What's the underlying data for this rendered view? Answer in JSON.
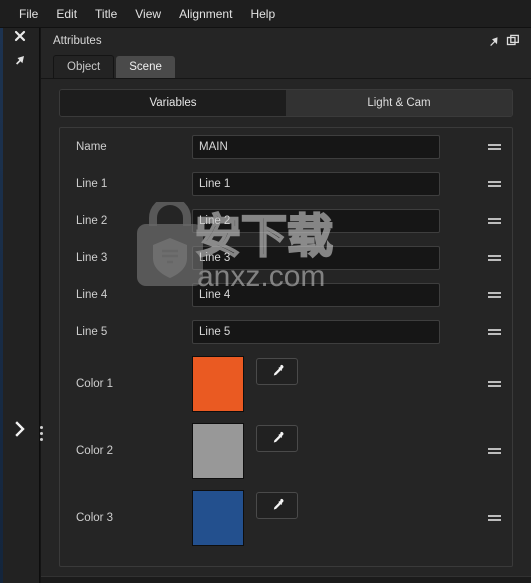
{
  "menubar": {
    "items": [
      {
        "label": "File"
      },
      {
        "label": "Edit"
      },
      {
        "label": "Title"
      },
      {
        "label": "View"
      },
      {
        "label": "Alignment"
      },
      {
        "label": "Help"
      }
    ]
  },
  "rail": {
    "close_icon": "close-icon",
    "arrow_icon": "cursor-arrow-icon",
    "expand_icon": "chevron-right-icon",
    "expand_glyph": "❯",
    "close_glyph": "✖",
    "arrow_glyph": "➤"
  },
  "panel": {
    "title": "Attributes",
    "pin_icon": "pin-icon",
    "float_icon": "float-window-icon",
    "tabs": [
      {
        "label": "Object",
        "active": false
      },
      {
        "label": "Scene",
        "active": true
      }
    ]
  },
  "segmented": {
    "options": [
      {
        "label": "Variables",
        "selected": true
      },
      {
        "label": "Light & Cam",
        "selected": false
      }
    ]
  },
  "variables": {
    "text_rows": [
      {
        "label": "Name",
        "value": "MAIN"
      },
      {
        "label": "Line 1",
        "value": "Line 1"
      },
      {
        "label": "Line 2",
        "value": "Line 2"
      },
      {
        "label": "Line 3",
        "value": "Line 3"
      },
      {
        "label": "Line 4",
        "value": "Line 4"
      },
      {
        "label": "Line 5",
        "value": "Line 5"
      }
    ],
    "color_rows": [
      {
        "label": "Color 1",
        "color": "#EA5A22",
        "picker_icon": "eyedropper-icon"
      },
      {
        "label": "Color 2",
        "color": "#989898",
        "picker_icon": "eyedropper-icon"
      },
      {
        "label": "Color 3",
        "color": "#23508E",
        "picker_icon": "eyedropper-icon"
      }
    ],
    "drag_handle_icon": "drag-handle-icon"
  },
  "watermark": {
    "cn_text": "安下载",
    "domain_text": "anxz.com",
    "lock_icon": "lock-shield-icon"
  },
  "theme": {
    "accent_orange": "#EA5A22",
    "accent_gray": "#989898",
    "accent_blue": "#23508E",
    "panel_bg": "#252525",
    "field_bg": "#161616"
  }
}
